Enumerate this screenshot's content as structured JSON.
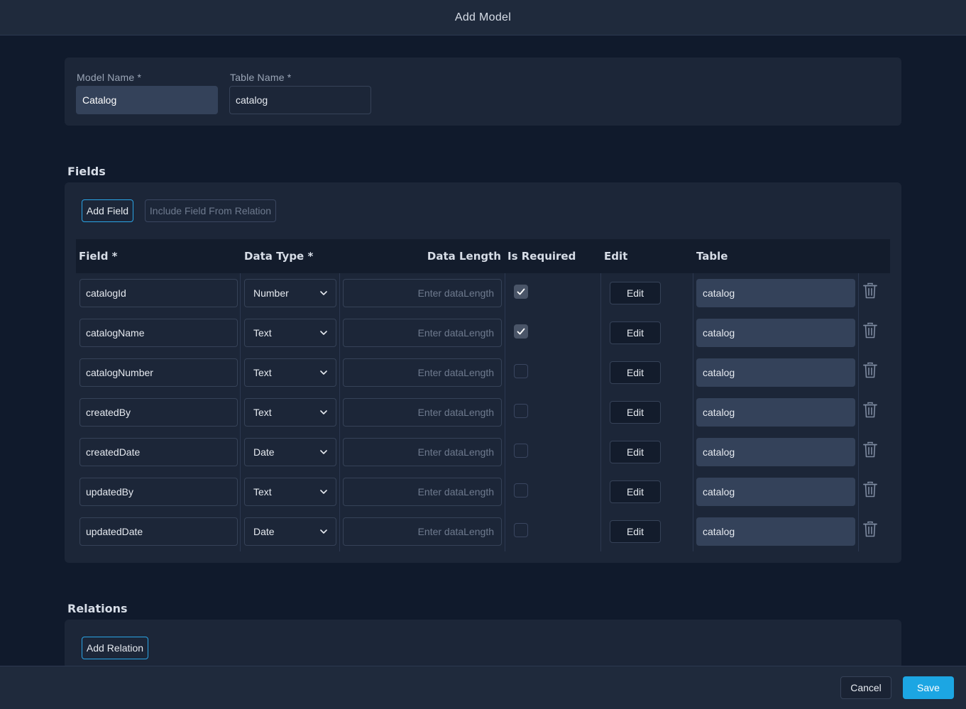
{
  "window": {
    "title": "Add Model"
  },
  "model": {
    "model_name_label": "Model Name *",
    "model_name_value": "Catalog",
    "table_name_label": "Table Name *",
    "table_name_value": "catalog"
  },
  "fields": {
    "section_title": "Fields",
    "add_field_label": "Add Field",
    "include_field_label": "Include Field From Relation",
    "columns": {
      "field": "Field *",
      "data_type": "Data Type *",
      "data_length": "Data Length",
      "is_required": "Is Required",
      "edit": "Edit",
      "table": "Table"
    },
    "length_placeholder": "Enter dataLength",
    "edit_label": "Edit",
    "rows": [
      {
        "field": "catalogId",
        "data_type": "Number",
        "required": true,
        "table": "catalog"
      },
      {
        "field": "catalogName",
        "data_type": "Text",
        "required": true,
        "table": "catalog"
      },
      {
        "field": "catalogNumber",
        "data_type": "Text",
        "required": false,
        "table": "catalog"
      },
      {
        "field": "createdBy",
        "data_type": "Text",
        "required": false,
        "table": "catalog"
      },
      {
        "field": "createdDate",
        "data_type": "Date",
        "required": false,
        "table": "catalog"
      },
      {
        "field": "updatedBy",
        "data_type": "Text",
        "required": false,
        "table": "catalog"
      },
      {
        "field": "updatedDate",
        "data_type": "Date",
        "required": false,
        "table": "catalog"
      }
    ]
  },
  "relations": {
    "section_title": "Relations",
    "add_relation_label": "Add Relation"
  },
  "footer": {
    "cancel_label": "Cancel",
    "save_label": "Save"
  },
  "colors": {
    "accent": "#1ca6e3",
    "background": "#101a2c",
    "card": "#1c2638"
  }
}
